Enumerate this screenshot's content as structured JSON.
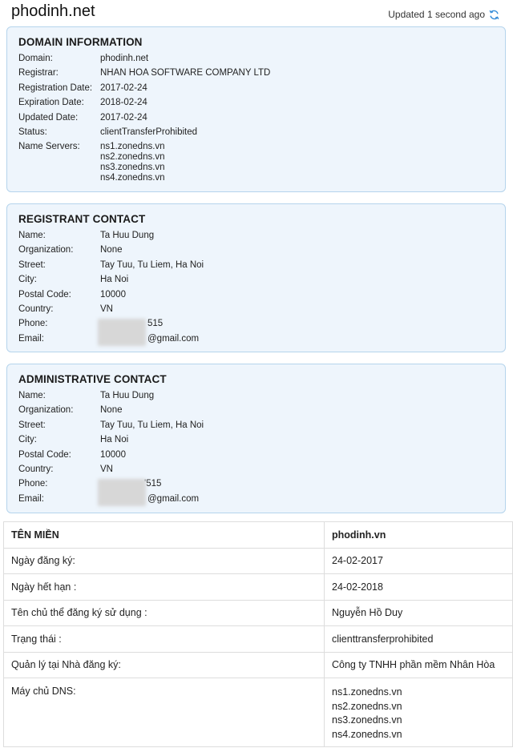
{
  "header": {
    "site": "phodinh.net",
    "updated": "Updated 1 second ago",
    "refresh_icon": "refresh-icon"
  },
  "domain_info": {
    "title": "DOMAIN INFORMATION",
    "rows": [
      {
        "label": "Domain:",
        "value": "phodinh.net"
      },
      {
        "label": "Registrar:",
        "value": "NHAN HOA SOFTWARE COMPANY LTD"
      },
      {
        "label": "Registration Date:",
        "value": "2017-02-24"
      },
      {
        "label": "Expiration Date:",
        "value": "2018-02-24"
      },
      {
        "label": "Updated Date:",
        "value": "2017-02-24"
      },
      {
        "label": "Status:",
        "value": "clientTransferProhibited"
      }
    ],
    "name_servers_label": "Name Servers:",
    "name_servers": [
      "ns1.zonedns.vn",
      "ns2.zonedns.vn",
      "ns3.zonedns.vn",
      "ns4.zonedns.vn"
    ]
  },
  "registrant": {
    "title": "REGISTRANT CONTACT",
    "rows": [
      {
        "label": "Name:",
        "value": "Ta Huu Dung"
      },
      {
        "label": "Organization:",
        "value": "None"
      },
      {
        "label": "Street:",
        "value": "Tay Tuu, Tu Liem, Ha Noi"
      },
      {
        "label": "City:",
        "value": "Ha Noi"
      },
      {
        "label": "Postal Code:",
        "value": "10000"
      },
      {
        "label": "Country:",
        "value": "VN"
      },
      {
        "label": "Phone:",
        "value": "515"
      },
      {
        "label": "Email:",
        "value": "@gmail.com"
      }
    ]
  },
  "administrative": {
    "title": "ADMINISTRATIVE CONTACT",
    "rows": [
      {
        "label": "Name:",
        "value": "Ta Huu Dung"
      },
      {
        "label": "Organization:",
        "value": "None"
      },
      {
        "label": "Street:",
        "value": "Tay Tuu, Tu Liem, Ha Noi"
      },
      {
        "label": "City:",
        "value": "Ha Noi"
      },
      {
        "label": "Postal Code:",
        "value": "10000"
      },
      {
        "label": "Country:",
        "value": "VN"
      },
      {
        "label": "Phone:",
        "value": "'515"
      },
      {
        "label": "Email:",
        "value": "@gmail.com"
      }
    ]
  },
  "vn_table": {
    "rows": [
      {
        "label": "TÊN MIỀN",
        "value": "phodinh.vn"
      },
      {
        "label": "Ngày đăng ký:",
        "value": "24-02-2017"
      },
      {
        "label": "Ngày hết hạn :",
        "value": "24-02-2018"
      },
      {
        "label": "Tên chủ thể đăng ký sử dụng :",
        "value": "Nguyễn Hồ Duy"
      },
      {
        "label": "Trạng thái :",
        "value": "clienttransferprohibited"
      },
      {
        "label": "Quản lý tại Nhà đăng ký:",
        "value": "Công ty TNHH phần mềm Nhân Hòa"
      }
    ],
    "dns_label": "Máy chủ DNS:",
    "dns": [
      "ns1.zonedns.vn",
      "ns2.zonedns.vn",
      "ns3.zonedns.vn",
      "ns4.zonedns.vn"
    ]
  },
  "colors": {
    "panel_bg": "#eef5fc",
    "panel_border": "#b5d4ec",
    "refresh": "#3a8fd9"
  }
}
